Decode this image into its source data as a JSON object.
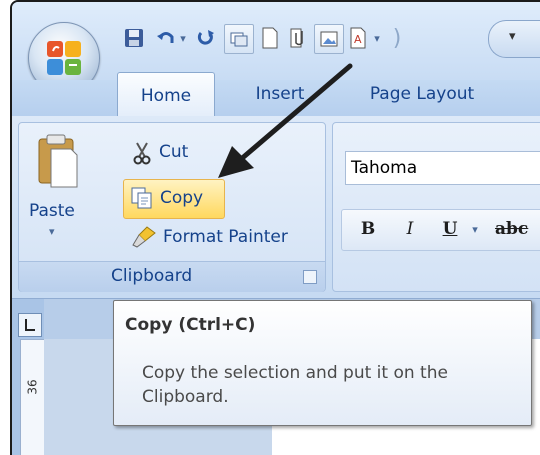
{
  "tabs": [
    {
      "label": "Home",
      "active": true
    },
    {
      "label": "Insert"
    },
    {
      "label": "Page Layout"
    }
  ],
  "clipboard": {
    "paste_label": "Paste",
    "cut_label": "Cut",
    "copy_label": "Copy",
    "format_painter_label": "Format Painter",
    "group_label": "Clipboard"
  },
  "font": {
    "font_name": "Tahoma",
    "bold_label": "B",
    "italic_label": "I",
    "underline_label": "U",
    "strike_label": "abc"
  },
  "ruler": {
    "tick_label": "36"
  },
  "tooltip": {
    "title": "Copy (Ctrl+C)",
    "body": "Copy the selection and put it on the Clipboard."
  },
  "colors": {
    "accent": "#15428b",
    "copy_highlight": "#ffd85e",
    "arrow": "#1e1e1e"
  },
  "icons": {
    "office": "office-logo-icon",
    "save": "save-icon",
    "undo": "undo-icon",
    "redo": "redo-icon"
  }
}
